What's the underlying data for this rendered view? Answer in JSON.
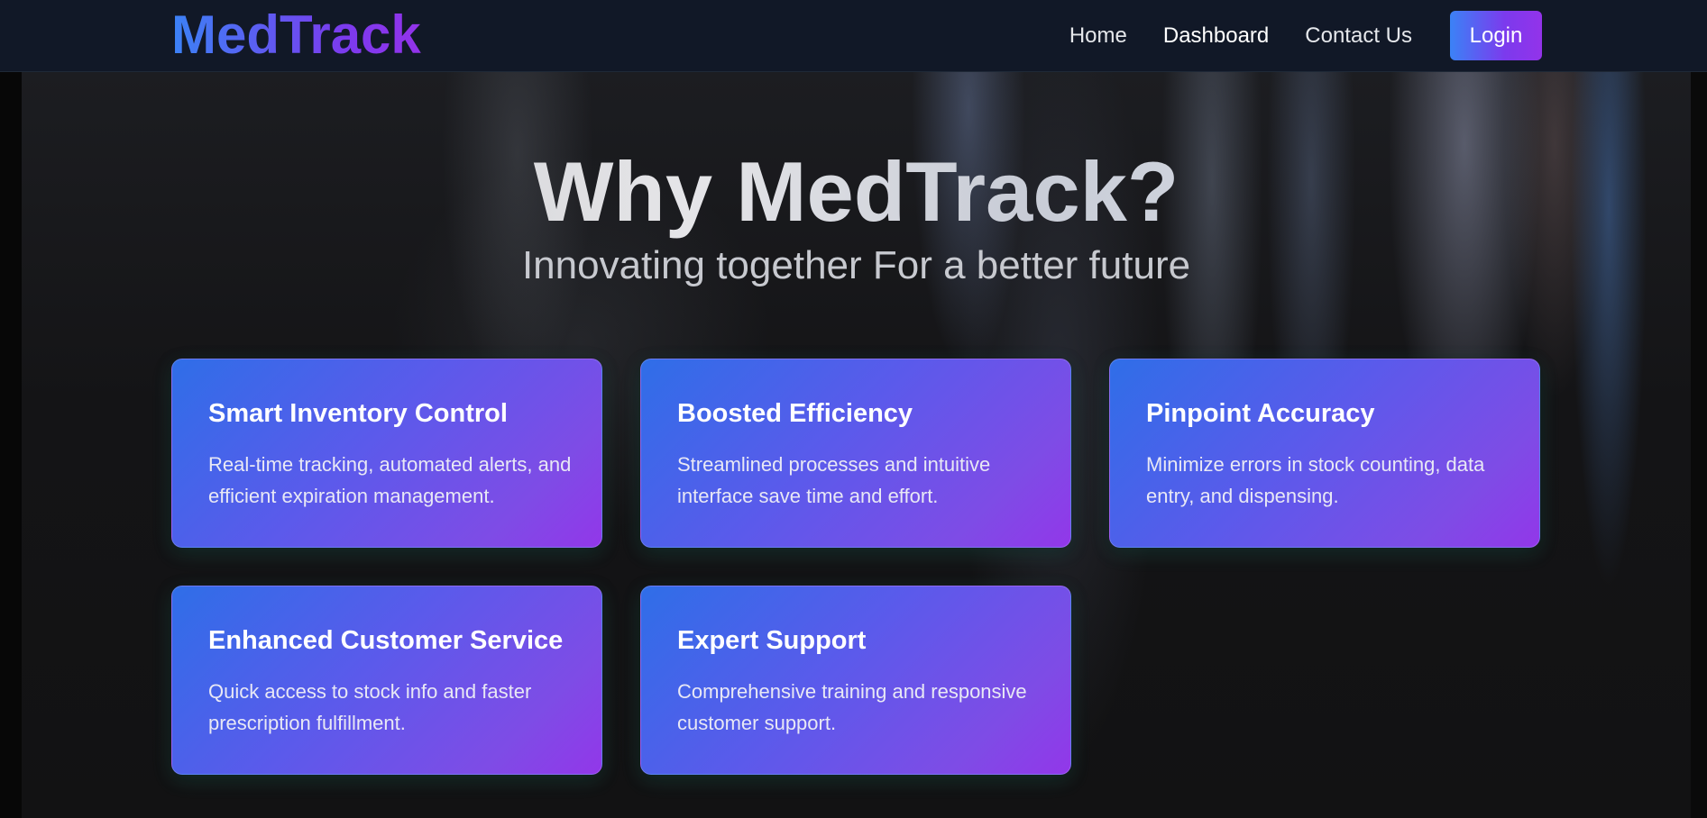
{
  "brand": {
    "logo_text": "MedTrack"
  },
  "nav": {
    "links": [
      {
        "label": "Home"
      },
      {
        "label": "Dashboard"
      },
      {
        "label": "Contact Us"
      }
    ],
    "login_label": "Login"
  },
  "hero": {
    "title": "Why MedTrack?",
    "subtitle": "Innovating together For a better future"
  },
  "features": [
    {
      "title": "Smart Inventory Control",
      "description": "Real-time tracking, automated alerts, and efficient expiration management."
    },
    {
      "title": "Boosted Efficiency",
      "description": "Streamlined processes and intuitive interface save time and effort."
    },
    {
      "title": "Pinpoint Accuracy",
      "description": "Minimize errors in stock counting, data entry, and dispensing."
    },
    {
      "title": "Enhanced Customer Service",
      "description": "Quick access to stock info and faster prescription fulfillment."
    },
    {
      "title": "Expert Support",
      "description": "Comprehensive training and responsive customer support."
    }
  ],
  "colors": {
    "navbar_bg": "#111827",
    "accent_start": "#3b82f6",
    "accent_end": "#9333ea",
    "card_text": "#ffffff"
  }
}
